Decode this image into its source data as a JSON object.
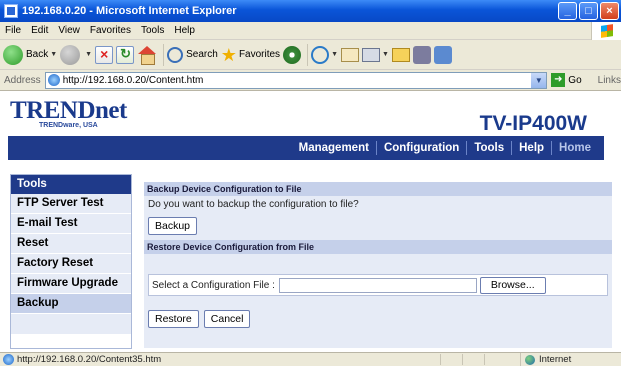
{
  "window": {
    "title": "192.168.0.20 - Microsoft Internet Explorer",
    "min": "_",
    "max": "□",
    "close": "×"
  },
  "menu": [
    "File",
    "Edit",
    "View",
    "Favorites",
    "Tools",
    "Help"
  ],
  "toolbar": {
    "back": "Back",
    "search": "Search",
    "favorites": "Favorites"
  },
  "address": {
    "label": "Address",
    "url": "http://192.168.0.20/Content.htm",
    "go": "Go",
    "links": "Links"
  },
  "page": {
    "logo": "TRENDnet",
    "logo_sub": "TRENDware, USA",
    "model": "TV-IP400W",
    "nav": [
      "Management",
      "Configuration",
      "Tools",
      "Help",
      "Home"
    ],
    "sidebar": {
      "header": "Tools",
      "items": [
        "FTP Server Test",
        "E-mail Test",
        "Reset",
        "Factory Reset",
        "Firmware Upgrade",
        "Backup"
      ],
      "active": "Backup"
    },
    "backup": {
      "title": "Backup Device Configuration to File",
      "question": "Do you want to backup the configuration to file?",
      "button": "Backup"
    },
    "restore": {
      "title": "Restore Device Configuration from File",
      "file_label": "Select a Configuration File :",
      "file_value": "",
      "browse": "Browse...",
      "restore_button": "Restore",
      "cancel_button": "Cancel"
    }
  },
  "status": {
    "url": "http://192.168.0.20/Content35.htm",
    "zone": "Internet"
  },
  "colors": {
    "brand_navy": "#1f3a8a",
    "panel_light": "#e6ebf6",
    "panel_mid": "#c5d0ea"
  }
}
